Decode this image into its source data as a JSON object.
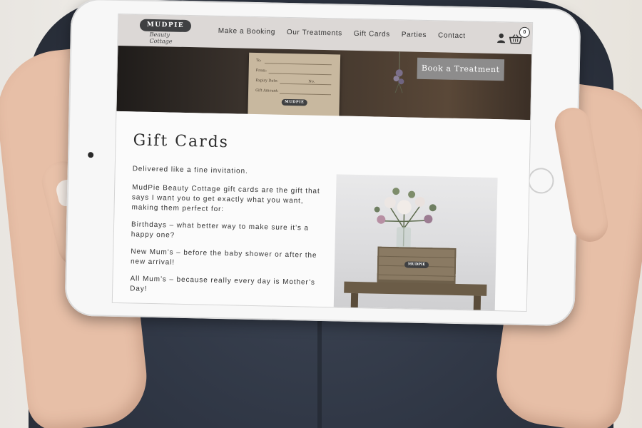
{
  "site": {
    "logo_text": "MUDPIE",
    "logo_script": "Beauty Cottage",
    "nav": [
      "Make a Booking",
      "Our Treatments",
      "Gift Cards",
      "Parties",
      "Contact"
    ],
    "cart_count": "0"
  },
  "hero": {
    "cta_label": "Book a Treatment",
    "card_fields": [
      "To:",
      "From:",
      "Expiry Date:",
      "No.",
      "Gift Amount:"
    ],
    "card_logo": "MUDPIE"
  },
  "content": {
    "title": "Gift Cards",
    "paragraphs": [
      "Delivered like a fine invitation.",
      "MudPie Beauty Cottage gift cards are the gift that says I want you to get exactly what you want, making them perfect for:",
      "Birthdays – what better way to make sure it’s a happy one?",
      "New Mum’s – before the baby shower or after the new arrival!",
      "All Mum’s – because really every day is Mother’s Day!"
    ],
    "crate_label": "MUDPIE"
  },
  "colors": {
    "nav_bg": "#dcd8d6",
    "cta_bg": "#8d8c8c",
    "logo_dark": "#3f4042"
  }
}
